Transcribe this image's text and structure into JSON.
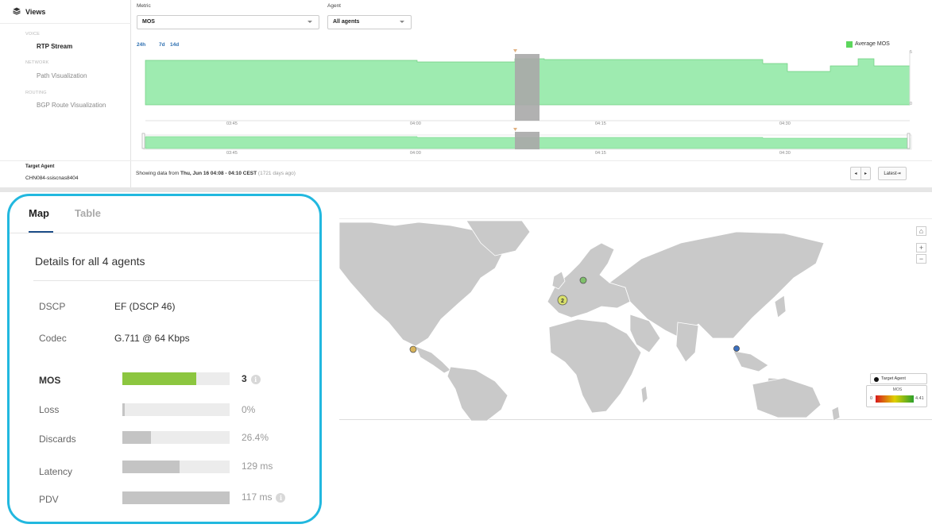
{
  "sidebar": {
    "title": "Views",
    "sections": [
      {
        "label": "VOICE",
        "items": [
          {
            "label": "RTP Stream",
            "active": true
          }
        ]
      },
      {
        "label": "NETWORK",
        "items": [
          {
            "label": "Path Visualization",
            "active": false
          }
        ]
      },
      {
        "label": "ROUTING",
        "items": [
          {
            "label": "BGP Route Visualization",
            "active": false
          }
        ]
      }
    ],
    "target_agent_label": "Target Agent",
    "target_agent_value": "CHN084-ssiscnas8404"
  },
  "controls": {
    "metric_label": "Metric",
    "metric_value": "MOS",
    "agent_label": "Agent",
    "agent_value": "All agents"
  },
  "timeline": {
    "ranges": [
      "24h",
      "7d",
      "14d"
    ],
    "legend": "Average MOS",
    "y_max_label": "5",
    "y_min_label": "0",
    "ticks": [
      "03:45",
      "04:00",
      "04:15",
      "04:30"
    ],
    "mini_ticks": [
      "03:45",
      "04:00",
      "04:15",
      "04:30"
    ],
    "colors": {
      "area": "#9eebb0",
      "area_stroke": "#6fcf80",
      "selection": "#a8a8a8"
    }
  },
  "status": {
    "prefix": "Showing data from",
    "range": "Thu, Jun 16 04:08 - 04:10 CEST",
    "ago": "(1721 days ago)",
    "prev_label": "◂",
    "next_label": "▸",
    "latest_label": "Latest⇥"
  },
  "panel": {
    "tabs": [
      {
        "label": "Map",
        "active": true
      },
      {
        "label": "Table",
        "active": false
      }
    ],
    "details_title": "Details for all 4 agents",
    "info_rows": [
      {
        "label": "DSCP",
        "value": "EF (DSCP 46)"
      },
      {
        "label": "Codec",
        "value": "G.711 @ 64 Kbps"
      }
    ],
    "metrics": [
      {
        "label": "MOS",
        "value": "3",
        "fraction": 0.69,
        "color": "#8cc63f",
        "bold": true,
        "info": true
      },
      {
        "label": "Loss",
        "value": "0%",
        "fraction": 0.02,
        "color": "#c4c4c4",
        "bold": false,
        "info": false
      },
      {
        "label": "Discards",
        "value": "26.4%",
        "fraction": 0.27,
        "color": "#c4c4c4",
        "bold": false,
        "info": false
      },
      {
        "label": "Latency",
        "value": "129 ms",
        "fraction": 0.53,
        "color": "#c4c4c4",
        "bold": false,
        "info": false
      },
      {
        "label": "PDV",
        "value": "117 ms",
        "fraction": 1.0,
        "color": "#c4c4c4",
        "bold": false,
        "info": true
      }
    ],
    "info_glyph": "i"
  },
  "map": {
    "zoom_home": "⌂",
    "zoom_in": "+",
    "zoom_out": "−",
    "legend_target": "Target Agent",
    "legend_mos_title": "MOS",
    "legend_min": "0",
    "legend_max": "4.41",
    "cluster_count": "2"
  }
}
